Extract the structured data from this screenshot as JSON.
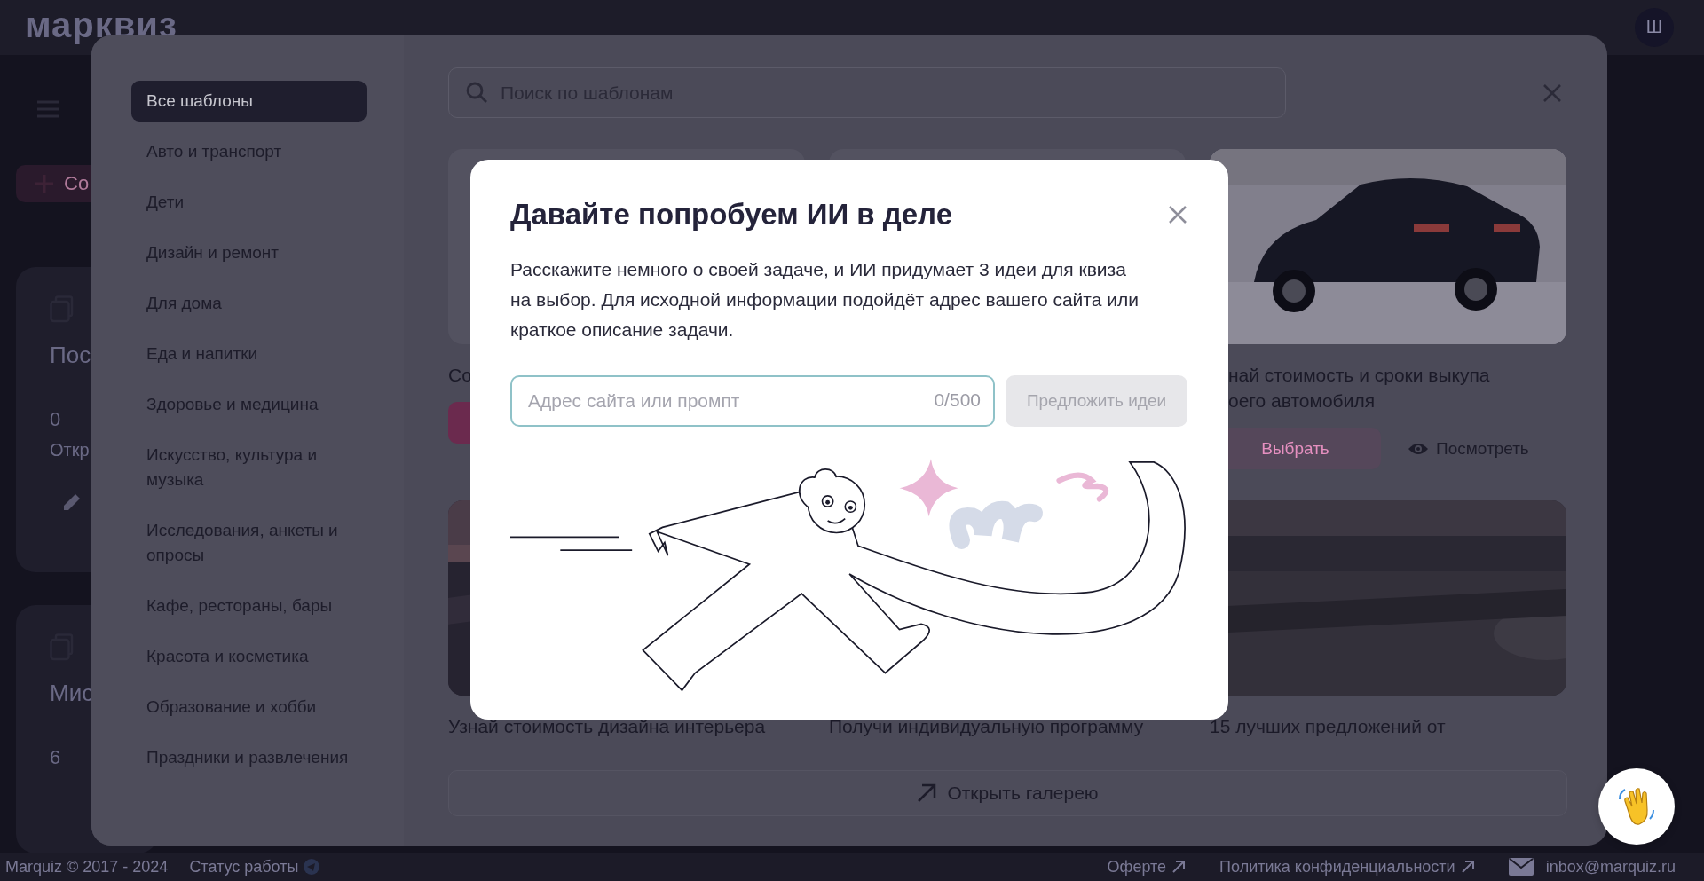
{
  "app": {
    "logo": "марквиз",
    "avatar": "Ш",
    "create_button": "Со",
    "quiz_cards": [
      {
        "title": "Пос",
        "count": "0",
        "count_label": "Откр",
        "edit": true
      },
      {
        "title": "Мис",
        "count": "6",
        "edit": false
      }
    ]
  },
  "footer": {
    "copyright": "Marquiz © 2017 - 2024",
    "status": "Статус работы",
    "links": [
      "Оферте",
      "Политика конфиденциальности"
    ],
    "email": "inbox@marquiz.ru"
  },
  "gallery": {
    "categories": [
      {
        "label": "Все шаблоны",
        "selected": true
      },
      {
        "label": "Авто и транспорт",
        "selected": false
      },
      {
        "label": "Дети",
        "selected": false
      },
      {
        "label": "Дизайн и ремонт",
        "selected": false
      },
      {
        "label": "Для дома",
        "selected": false
      },
      {
        "label": "Еда и напитки",
        "selected": false
      },
      {
        "label": "Здоровье и медицина",
        "selected": false
      },
      {
        "label": "Искусство, культура и музыка",
        "selected": false
      },
      {
        "label": "Исследования, анкеты и опросы",
        "selected": false
      },
      {
        "label": "Кафе, рестораны, бары",
        "selected": false
      },
      {
        "label": "Красота и косметика",
        "selected": false
      },
      {
        "label": "Образование и хобби",
        "selected": false
      },
      {
        "label": "Праздники и развлечения",
        "selected": false
      }
    ],
    "search": {
      "placeholder": "Поиск по шаблонам"
    },
    "cards": [
      {
        "kind": "plain",
        "title_lines": [
          "Со"
        ],
        "buttons": [
          {
            "kind": "select"
          }
        ]
      },
      {
        "kind": "plain"
      },
      {
        "kind": "picture",
        "title_lines": [
          "най стоимость и сроки выкупа",
          "оего автомобиля"
        ],
        "buttons": [
          {
            "kind": "select",
            "label": "Выбрать"
          },
          {
            "kind": "view",
            "label": "Посмотреть"
          }
        ]
      },
      {
        "kind": "picture",
        "title_lines": [
          "Узнай стоимость дизайна интерьера"
        ]
      },
      {
        "kind": "covered",
        "title_lines": [
          "Получи индивидуальную программу"
        ]
      },
      {
        "kind": "picture",
        "title_lines": [
          "15 лучших предложений от"
        ]
      }
    ],
    "open_button": "Открыть галерею"
  },
  "dialog": {
    "title": "Давайте попробуем ИИ в деле",
    "text": "Расскажите немного о своей задаче, и ИИ придумает 3 идеи для квиза на выбор. Для исходной информации подойдёт адрес вашего сайта или краткое описание задачи.",
    "input": {
      "placeholder": "Адрес сайта или промпт",
      "counter": "0/500"
    },
    "submit": {
      "label": "Предложить идеи",
      "disabled": true
    }
  }
}
